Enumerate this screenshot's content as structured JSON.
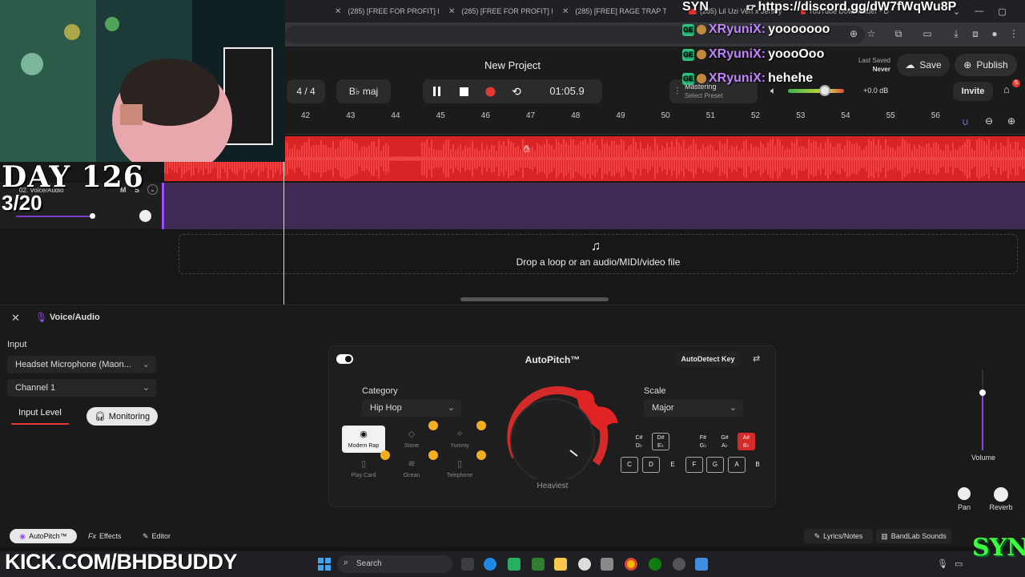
{
  "browser": {
    "tabs": [
      {
        "label": "(285) [FREE FOR PROFIT] I"
      },
      {
        "label": "(285) [FREE FOR PROFIT] I"
      },
      {
        "label": "(285) [FREE] RAGE TRAP T"
      },
      {
        "label": "(285) Lil Uzi Vert x Jersey"
      },
      {
        "label": "YouTube Downloader - D"
      }
    ]
  },
  "overlay": {
    "day": "DAY 126",
    "date": "3/20",
    "kick": "KICK.COM/BHDBUDDY",
    "syn_top": "SYN",
    "discord": "https://discord.gg/dW7fWqWu8P",
    "chat": [
      {
        "user": "XRyuniX:",
        "msg": "yooooooo"
      },
      {
        "user": "XRyuniX:",
        "msg": "yoooOoo"
      },
      {
        "user": "XRyuniX:",
        "msg": "hehehe"
      }
    ],
    "logo": "SYN"
  },
  "header": {
    "project_title": "New Project",
    "time_signature": "4 / 4",
    "key": "B♭ maj",
    "time": "01:05.9",
    "mastering_label": "Mastering",
    "select_preset": "Select Preset",
    "gain": "+0.0 dB",
    "last_saved_label": "Last Saved",
    "last_saved_value": "Never",
    "save_label": "Save",
    "publish_label": "Publish",
    "invite_label": "Invite",
    "notif_count": "5"
  },
  "ruler": [
    "42",
    "43",
    "44",
    "45",
    "46",
    "47",
    "48",
    "49",
    "50",
    "51",
    "52",
    "53",
    "54",
    "55",
    "56"
  ],
  "tracks": {
    "track2_name": "02. Voice/Audio",
    "track2_mute": "M",
    "track2_solo": "S",
    "drop_text": "Drop a loop or an audio/MIDI/video file"
  },
  "panel": {
    "title": "Voice/Audio",
    "input_label": "Input",
    "input_device": "Headset Microphone (Maon...",
    "channel": "Channel 1",
    "input_level_tab": "Input Level",
    "monitoring_tab": "Monitoring",
    "autopitch": {
      "title": "AutoPitch™",
      "autodetect": "AutoDetect Key",
      "category_label": "Category",
      "category_value": "Hip Hop",
      "scale_label": "Scale",
      "scale_value": "Major",
      "knob_label": "Heaviest",
      "styles": [
        {
          "name": "Modern Rap",
          "icon": "modern-rap-icon",
          "selected": true
        },
        {
          "name": "Stone",
          "icon": "stone-icon",
          "crown": true
        },
        {
          "name": "Yummy",
          "icon": "yummy-icon",
          "crown": true
        },
        {
          "name": "Play Card",
          "icon": "play-card-icon",
          "crown": true
        },
        {
          "name": "Ocean",
          "icon": "ocean-icon",
          "crown": true
        },
        {
          "name": "Telephone",
          "icon": "telephone-icon",
          "crown": true
        }
      ],
      "sharps": [
        {
          "top": "C#",
          "bottom": "D♭",
          "boxed": false
        },
        {
          "top": "D#",
          "bottom": "E♭",
          "boxed": true
        },
        {
          "top": "F#",
          "bottom": "G♭",
          "boxed": false
        },
        {
          "top": "G#",
          "bottom": "A♭",
          "boxed": false
        },
        {
          "top": "A#",
          "bottom": "B♭",
          "active": true
        }
      ],
      "naturals": [
        "C",
        "D",
        "E",
        "F",
        "G",
        "A",
        "B"
      ]
    },
    "volume_label": "Volume",
    "pan_label": "Pan",
    "reverb_label": "Reverb"
  },
  "footer": {
    "autopitch_tab": "AutoPitch™",
    "fx_prefix": "Fx",
    "effects_tab": "Effects",
    "editor_tab": "Editor",
    "lyrics_tab": "Lyrics/Notes",
    "bandlab_tab": "BandLab Sounds"
  },
  "taskbar": {
    "search_placeholder": "Search"
  }
}
